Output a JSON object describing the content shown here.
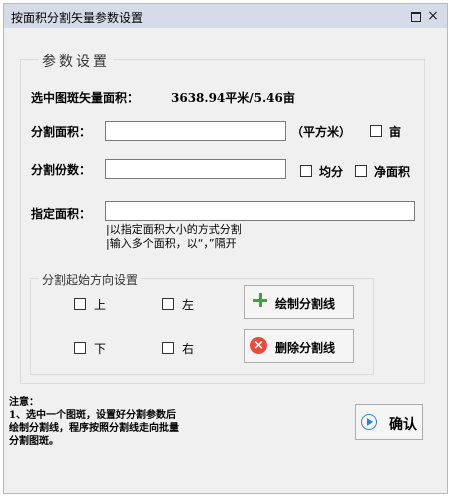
{
  "window": {
    "title": "按面积分割矢量参数设置",
    "restore_icon": "restore-icon",
    "close_icon": "close-icon",
    "close_glyph": "×"
  },
  "params_group": {
    "legend": "参数设置",
    "selected_area_label": "选中图斑矢量面积：",
    "selected_area_value": "3638.94平米/5.46亩",
    "split_area_label": "分割面积：",
    "split_area_value": "",
    "unit_sqm_label": "（平方米）",
    "unit_mu_label": "亩",
    "split_count_label": "分割份数：",
    "split_count_value": "",
    "equal_label": "均分",
    "net_area_label": "净面积",
    "specified_area_label": "指定面积：",
    "specified_area_value": "",
    "hint_line1": "|以指定面积大小的方式分割",
    "hint_line2": "|输入多个面积，以“，”隔开"
  },
  "direction_group": {
    "legend": "分割起始方向设置",
    "up_label": "上",
    "left_label": "左",
    "down_label": "下",
    "right_label": "右"
  },
  "buttons": {
    "draw_split_line": "绘制分割线",
    "delete_split_line": "删除分割线",
    "confirm": "确认"
  },
  "note": {
    "title": "注意：",
    "line1": "1、选中一个图斑，设置好分割参数后",
    "line2": "绘制分割线，程序按照分割线走向批量",
    "line3": "分割图斑。"
  },
  "colors": {
    "titlebar": "#d6dbe9",
    "panel": "#f0f0f0",
    "plus_icon": "#39a935",
    "delete_icon": "#e74d3c",
    "confirm_icon": "#2e86c8"
  }
}
